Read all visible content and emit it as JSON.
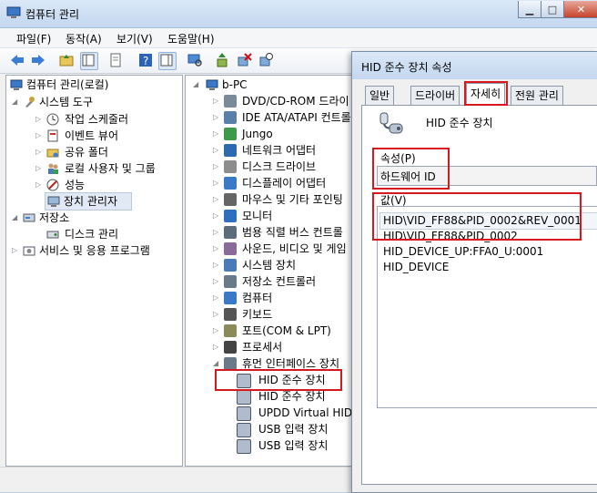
{
  "window": {
    "title": "컴퓨터 관리"
  },
  "menu": [
    "파일(F)",
    "동작(A)",
    "보기(V)",
    "도움말(H)"
  ],
  "left_tree": {
    "root": "컴퓨터 관리(로컬)",
    "system_tools": "시스템 도구",
    "task_scheduler": "작업 스케줄러",
    "event_viewer": "이벤트 뷰어",
    "shared_folders": "공유 폴더",
    "local_users": "로컬 사용자 및 그룹",
    "performance": "성능",
    "device_manager": "장치 관리자",
    "storage": "저장소",
    "disk_management": "디스크 관리",
    "services": "서비스 및 응용 프로그램"
  },
  "device_tree": {
    "computer": "b-PC",
    "items": [
      "DVD/CD-ROM 드라이",
      "IDE ATA/ATAPI 컨트롤",
      "Jungo",
      "네트워크 어댑터",
      "디스크 드라이브",
      "디스플레이 어댑터",
      "마우스 및 기타 포인팅",
      "모니터",
      "범용 직렬 버스 컨트롤",
      "사운드, 비디오 및 게임",
      "시스템 장치",
      "저장소 컨트롤러",
      "컴퓨터",
      "키보드",
      "포트(COM & LPT)",
      "프로세서",
      "휴먼 인터페이스 장치"
    ],
    "hid_children": [
      "HID 준수 장치",
      "HID 준수 장치",
      "UPDD Virtual HID",
      "USB 입력 장치",
      "USB 입력 장치"
    ]
  },
  "dialog": {
    "title": "HID 준수 장치 속성",
    "tabs": [
      "일반",
      "드라이버",
      "자세히",
      "전원 관리"
    ],
    "device_name": "HID 준수 장치",
    "property_label": "속성(P)",
    "property_value": "하드웨어 ID",
    "value_label": "값(V)",
    "values": [
      "HID\\VID_FF88&PID_0002&REV_0001",
      "HID\\VID_FF88&PID_0002",
      "HID_DEVICE_UP:FFA0_U:0001",
      "HID_DEVICE"
    ]
  }
}
